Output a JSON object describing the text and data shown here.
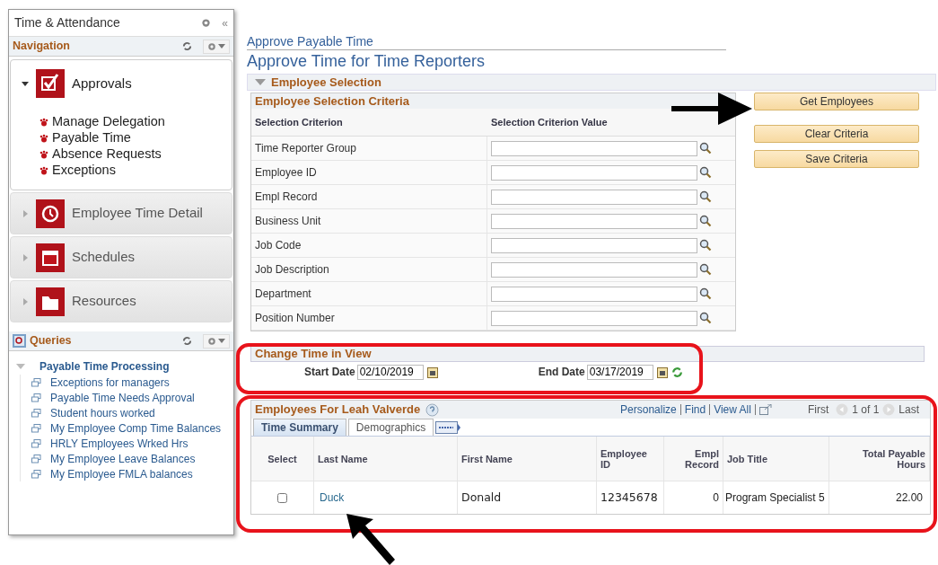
{
  "sidebar": {
    "title": "Time & Attendance",
    "collapse": "«",
    "navigation": {
      "title": "Navigation",
      "groups": [
        {
          "label": "Approvals",
          "expanded": true,
          "items": [
            "Manage Delegation",
            "Payable Time",
            "Absence Requests",
            "Exceptions"
          ]
        },
        {
          "label": "Employee Time Detail",
          "expanded": false
        },
        {
          "label": "Schedules",
          "expanded": false
        },
        {
          "label": "Resources",
          "expanded": false
        }
      ]
    },
    "queries": {
      "title": "Queries",
      "folders": [
        {
          "label": "Payable Time Processing",
          "expanded": true,
          "children": [
            {
              "label": "Exceptions for managers"
            },
            {
              "label": "Payable Time Needs Approval"
            },
            {
              "label": "Student hours worked"
            },
            {
              "label": "My Employee Comp Time Balances"
            },
            {
              "label": "HRLY Employees Wrked Hrs"
            },
            {
              "label": "My Employee Leave Balances"
            },
            {
              "label": "My Employee FMLA balances"
            }
          ]
        }
      ]
    }
  },
  "breadcrumb": "Approve Payable Time",
  "page_title": "Approve Time for Time Reporters",
  "employee_selection": {
    "title": "Employee Selection",
    "expanded": true,
    "criteria": {
      "title": "Employee Selection Criteria",
      "columns": [
        "Selection Criterion",
        "Selection Criterion Value"
      ],
      "rows": [
        "Time Reporter Group",
        "Employee ID",
        "Empl Record",
        "Business Unit",
        "Job Code",
        "Job Description",
        "Department",
        "Position Number"
      ]
    },
    "buttons": [
      "Get Employees",
      "Clear Criteria",
      "Save Criteria"
    ]
  },
  "change_time": {
    "title": "Change Time in View",
    "start_label": "Start Date",
    "start_value": "02/10/2019",
    "end_label": "End Date",
    "end_value": "03/17/2019"
  },
  "employees": {
    "title": "Employees For Leah Valverde",
    "links": [
      "Personalize",
      "Find",
      "View All"
    ],
    "nav": {
      "first": "First",
      "count": "1 of 1",
      "last": "Last"
    },
    "tabs": [
      {
        "label": "Time Summary",
        "selected": true
      },
      {
        "label": "Demographics",
        "selected": false
      }
    ],
    "columns": [
      "Select",
      "Last Name",
      "First Name",
      "Employee ID",
      "Empl Record",
      "Job Title",
      "Total Payable Hours"
    ],
    "rows": [
      {
        "selected": false,
        "last_name": "Duck",
        "first_name": "Donald",
        "employee_id": "12345678",
        "empl_record": "0",
        "job_title": "Program Specialist 5",
        "hours": "22.00"
      }
    ]
  }
}
